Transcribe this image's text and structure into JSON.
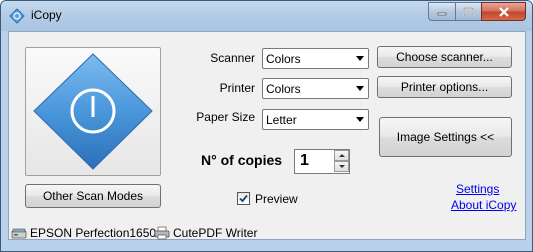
{
  "window": {
    "title": "iCopy",
    "minimize_label": "—",
    "maximize_label": "☐",
    "close_label": "✕"
  },
  "scan": {
    "other_modes_label": "Other Scan Modes"
  },
  "form": {
    "scanner_label": "Scanner",
    "scanner_value": "Colors",
    "printer_label": "Printer",
    "printer_value": "Colors",
    "paper_size_label": "Paper Size",
    "paper_size_value": "Letter",
    "copies_label": "N° of copies",
    "copies_value": "1",
    "preview_label": "Preview",
    "preview_checked": true
  },
  "buttons": {
    "choose_scanner": "Choose scanner...",
    "printer_options": "Printer options...",
    "image_settings": "Image Settings <<"
  },
  "links": {
    "settings": "Settings",
    "about": "About iCopy"
  },
  "status": {
    "scanner_name": "EPSON Perfection1650",
    "printer_name": "CutePDF Writer"
  },
  "colors": {
    "window_frame": "#b9d1ea",
    "client_bg": "#f0f0f0",
    "logo_blue": "#4a97db",
    "link": "#0000ee"
  },
  "icons": [
    "icopy-app-icon",
    "power-icon",
    "scanner-icon",
    "printer-icon",
    "checkmark-icon"
  ]
}
